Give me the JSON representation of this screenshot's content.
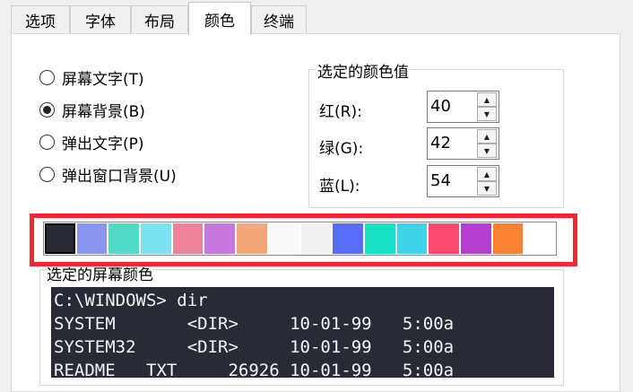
{
  "tabs": [
    {
      "label": "选项"
    },
    {
      "label": "字体"
    },
    {
      "label": "布局"
    },
    {
      "label": "颜色"
    },
    {
      "label": "终端"
    }
  ],
  "active_tab": "颜色",
  "radios": [
    {
      "label": "屏幕文字(T)",
      "checked": false
    },
    {
      "label": "屏幕背景(B)",
      "checked": true
    },
    {
      "label": "弹出文字(P)",
      "checked": false
    },
    {
      "label": "弹出窗口背景(U)",
      "checked": false
    }
  ],
  "color_values": {
    "legend": "选定的颜色值",
    "red_label": "红(R):",
    "red_value": "40",
    "green_label": "绿(G):",
    "green_value": "42",
    "blue_label": "蓝(L):",
    "blue_value": "54"
  },
  "palette": [
    "#282a36",
    "#8a95f2",
    "#4fdbc7",
    "#7ae3ef",
    "#f0839c",
    "#c877dc",
    "#f2a679",
    "#fafafa",
    "#f1f1f1",
    "#5a6dfa",
    "#1ae0c3",
    "#3fd4ea",
    "#fb4a6f",
    "#b43fcf",
    "#fc8234",
    "#ffffff"
  ],
  "selected_swatch_index": 0,
  "preview": {
    "label": "选定的屏幕颜色",
    "lines": [
      "C:\\WINDOWS> dir",
      "SYSTEM       <DIR>     10-01-99   5:00a",
      "SYSTEM32     <DIR>     10-01-99   5:00a",
      "README   TXT     26926 10-01-99   5:00a"
    ]
  },
  "highlight_color": "#ee2a30"
}
